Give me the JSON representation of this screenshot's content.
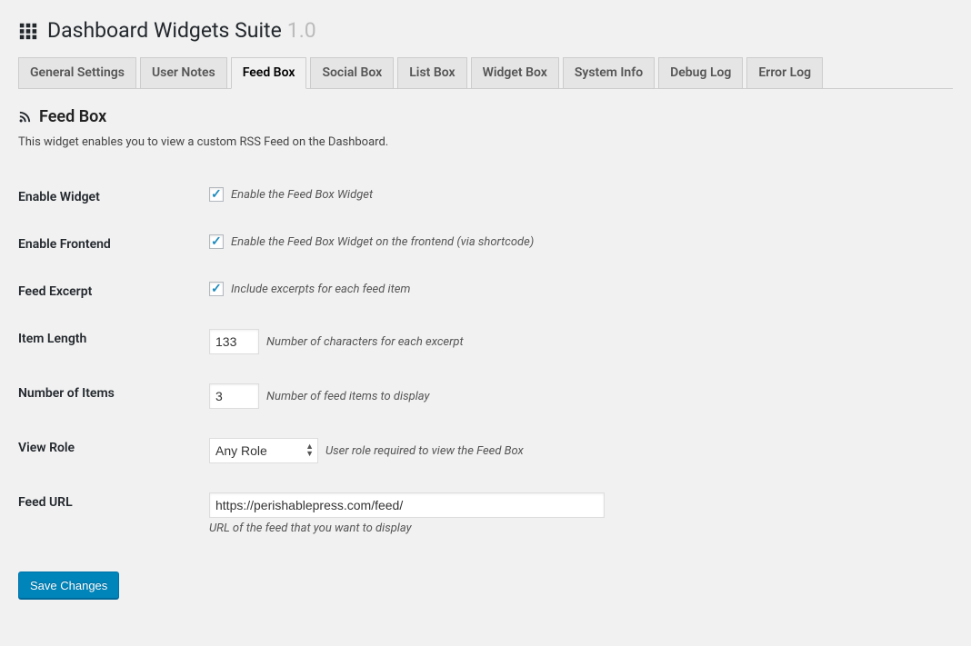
{
  "page": {
    "title": "Dashboard Widgets Suite",
    "version": "1.0"
  },
  "tabs": [
    {
      "label": "General Settings",
      "active": false
    },
    {
      "label": "User Notes",
      "active": false
    },
    {
      "label": "Feed Box",
      "active": true
    },
    {
      "label": "Social Box",
      "active": false
    },
    {
      "label": "List Box",
      "active": false
    },
    {
      "label": "Widget Box",
      "active": false
    },
    {
      "label": "System Info",
      "active": false
    },
    {
      "label": "Debug Log",
      "active": false
    },
    {
      "label": "Error Log",
      "active": false
    }
  ],
  "section": {
    "title": "Feed Box",
    "description": "This widget enables you to view a custom RSS Feed on the Dashboard."
  },
  "fields": {
    "enable_widget": {
      "label": "Enable Widget",
      "checked": true,
      "desc": "Enable the Feed Box Widget"
    },
    "enable_frontend": {
      "label": "Enable Frontend",
      "checked": true,
      "desc": "Enable the Feed Box Widget on the frontend (via shortcode)"
    },
    "feed_excerpt": {
      "label": "Feed Excerpt",
      "checked": true,
      "desc": "Include excerpts for each feed item"
    },
    "item_length": {
      "label": "Item Length",
      "value": "133",
      "desc": "Number of characters for each excerpt"
    },
    "number_items": {
      "label": "Number of Items",
      "value": "3",
      "desc": "Number of feed items to display"
    },
    "view_role": {
      "label": "View Role",
      "value": "Any Role",
      "desc": "User role required to view the Feed Box"
    },
    "feed_url": {
      "label": "Feed URL",
      "value": "https://perishablepress.com/feed/",
      "desc": "URL of the feed that you want to display"
    }
  },
  "submit": {
    "label": "Save Changes"
  }
}
